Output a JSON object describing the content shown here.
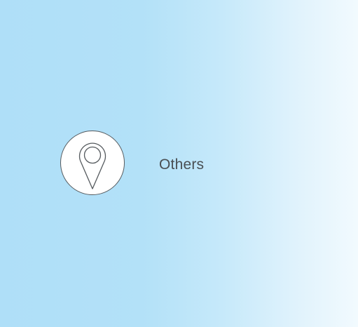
{
  "category": {
    "label": "Others",
    "icon": "map-pin-icon"
  },
  "colors": {
    "background_start": "#afdff8",
    "background_end": "#f2fafe",
    "icon_stroke": "#555a5e",
    "label_text": "#4a4f53"
  }
}
